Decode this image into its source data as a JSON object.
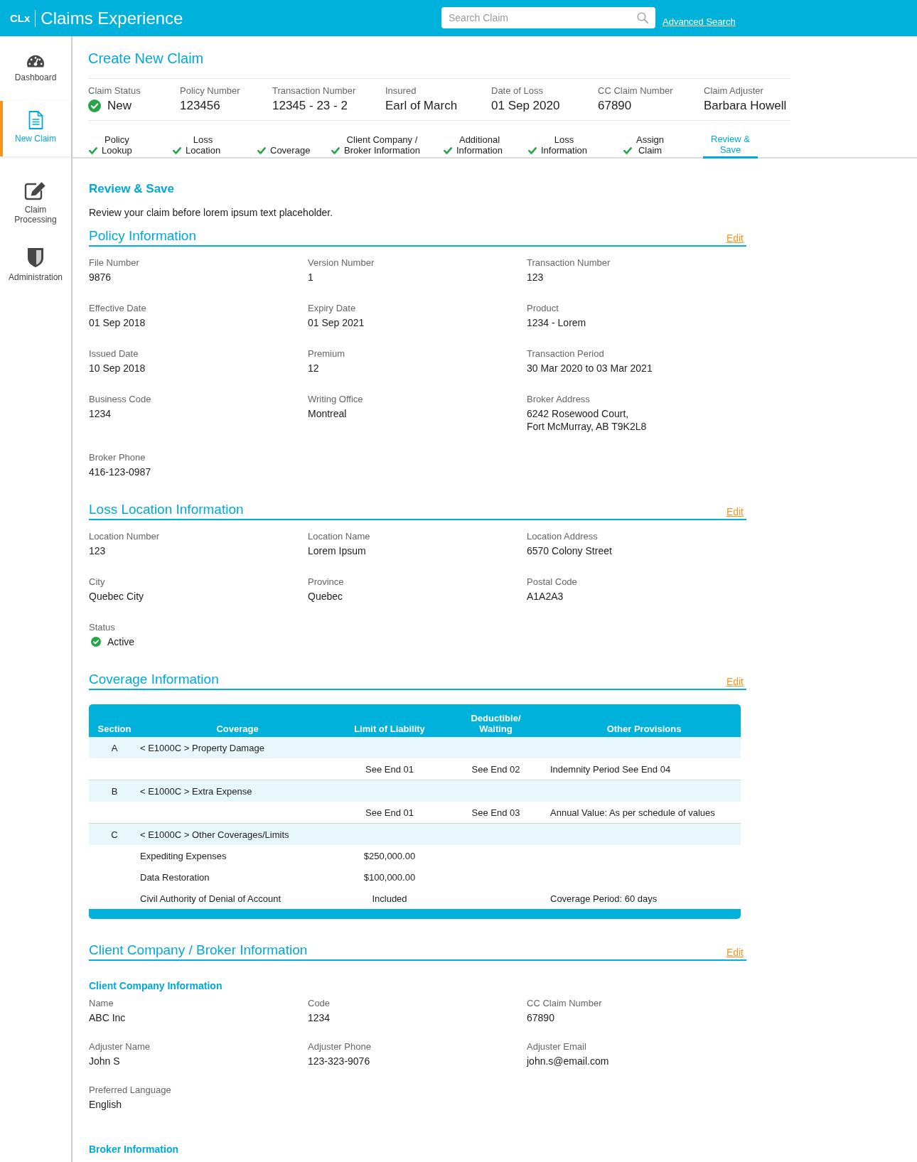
{
  "header": {
    "logo": "CLx",
    "title": "Claims Experience",
    "search": {
      "placeholder": "Search Claim"
    },
    "advanced_search": "Advanced Search"
  },
  "sidebar": {
    "items": [
      {
        "kind": "dashboard",
        "label": "Dashboard",
        "selected": false
      },
      {
        "kind": "claim",
        "label": "New Claim",
        "selected": true
      },
      {
        "kind": "processing",
        "label": "Claim Processing",
        "selected": false
      },
      {
        "kind": "administration",
        "label": "Administration",
        "selected": false
      }
    ]
  },
  "page_title": "Create New Claim",
  "claim_summary": [
    {
      "kind": "status",
      "label": "Claim Status",
      "value": "New"
    },
    {
      "kind": "text",
      "label": "Policy Number",
      "value": "123456"
    },
    {
      "kind": "text",
      "label": "Transaction Number",
      "value": "12345 - 23 - 2"
    },
    {
      "kind": "text",
      "label": "Insured",
      "value": "Earl of March"
    },
    {
      "kind": "text",
      "label": "Date of Loss",
      "value": "01 Sep 2020"
    },
    {
      "kind": "text",
      "label": "CC Claim Number",
      "value": "67890"
    },
    {
      "kind": "text",
      "label": "Claim Adjuster",
      "value": "Barbara Howell"
    }
  ],
  "steps": [
    {
      "label": "Policy\nLookup",
      "completed": true,
      "selected": false
    },
    {
      "label": "Loss\nLocation",
      "completed": true,
      "selected": false
    },
    {
      "label": "Coverage",
      "completed": true,
      "selected": false
    },
    {
      "label": "Client Company /\nBroker Information",
      "completed": true,
      "selected": false
    },
    {
      "label": "Additional\nInformation",
      "completed": true,
      "selected": false
    },
    {
      "label": "Loss\nInformation",
      "completed": true,
      "selected": false
    },
    {
      "label": "Assign\nClaim",
      "completed": true,
      "selected": false
    },
    {
      "label": "Review &\nSave",
      "completed": false,
      "selected": true
    }
  ],
  "review": {
    "title": "Review & Save",
    "description": "Review your claim before lorem ipsum text placeholder."
  },
  "sections": [
    {
      "kind": "fields",
      "title": "Policy Information",
      "edit": "Edit",
      "fields": [
        {
          "kind": "text",
          "label": "File Number",
          "value": "9876"
        },
        {
          "kind": "text",
          "label": "Version Number",
          "value": "1"
        },
        {
          "kind": "text",
          "label": "Transaction Number",
          "value": "123"
        },
        {
          "kind": "text",
          "label": "Effective Date",
          "value": "01 Sep 2018"
        },
        {
          "kind": "text",
          "label": "Expiry Date",
          "value": "01 Sep 2021"
        },
        {
          "kind": "text",
          "label": "Product",
          "value": "1234 - Lorem"
        },
        {
          "kind": "text",
          "label": "Issued Date",
          "value": "10 Sep 2018"
        },
        {
          "kind": "text",
          "label": "Premium",
          "value": "12"
        },
        {
          "kind": "text",
          "label": "Transaction Period",
          "value": "30 Mar 2020 to 03 Mar 2021"
        },
        {
          "kind": "text",
          "label": "Business Code",
          "value": "1234"
        },
        {
          "kind": "text",
          "label": "Writing Office",
          "value": "Montreal"
        },
        {
          "kind": "text",
          "label": "Broker Address",
          "value": "6242 Rosewood Court,\nFort McMurray, AB T9K2L8"
        },
        {
          "kind": "text",
          "label": "Broker Phone",
          "value": "416-123-0987"
        }
      ]
    },
    {
      "kind": "fields",
      "title": "Loss Location Information",
      "edit": "Edit",
      "fields": [
        {
          "kind": "text",
          "label": "Location Number",
          "value": "123"
        },
        {
          "kind": "text",
          "label": "Location Name",
          "value": "Lorem Ipsum"
        },
        {
          "kind": "text",
          "label": "Location Address",
          "value": "6570 Colony Street"
        },
        {
          "kind": "text",
          "label": "City",
          "value": "Quebec City"
        },
        {
          "kind": "text",
          "label": "Province",
          "value": "Quebec"
        },
        {
          "kind": "text",
          "label": "Postal Code",
          "value": "A1A2A3"
        },
        {
          "kind": "status",
          "label": "Status",
          "value": "Active"
        }
      ]
    },
    {
      "kind": "table",
      "title": "Coverage Information",
      "edit": "Edit",
      "table": {
        "columns": [
          "Section",
          "Coverage",
          "Limit of Liability",
          "Deductible/\nWaiting",
          "Other Provisions"
        ],
        "groups": [
          {
            "section": "A",
            "coverage": "< E1000C > Property Damage",
            "items": [
              {
                "limit": "See End 01",
                "deductible": "See End 02",
                "provisions": "Indemnity Period See End 04"
              }
            ]
          },
          {
            "section": "B",
            "coverage": "< E1000C > Extra Expense",
            "items": [
              {
                "limit": "See End 01",
                "deductible": "See End 03",
                "provisions": "Annual Value: As per schedule of values"
              }
            ]
          },
          {
            "section": "C",
            "coverage": "< E1000C > Other Coverages/Limits",
            "items": [
              {
                "coverage": "Expediting Expenses",
                "limit": "$250,000.00"
              },
              {
                "coverage": "Data Restoration",
                "limit": "$100,000.00"
              },
              {
                "coverage": "Civil Authority of Denial of Account",
                "limit": "Included",
                "provisions": "Coverage Period: 60 days"
              }
            ]
          }
        ]
      }
    },
    {
      "kind": "groups",
      "title": "Client Company / Broker Information",
      "edit": "Edit",
      "groups": [
        {
          "title": "Client Company Information",
          "fields": [
            {
              "kind": "text",
              "label": "Name",
              "value": "ABC Inc"
            },
            {
              "kind": "text",
              "label": "Code",
              "value": "1234"
            },
            {
              "kind": "text",
              "label": "CC Claim Number",
              "value": "67890"
            },
            {
              "kind": "text",
              "label": "Adjuster Name",
              "value": "John S"
            },
            {
              "kind": "text",
              "label": "Adjuster Phone",
              "value": "123-323-9076"
            },
            {
              "kind": "text",
              "label": "Adjuster Email",
              "value": "john.s@email.com"
            },
            {
              "kind": "text",
              "label": "Preferred Language",
              "value": "English"
            }
          ]
        },
        {
          "title": "Broker Information"
        }
      ]
    }
  ]
}
